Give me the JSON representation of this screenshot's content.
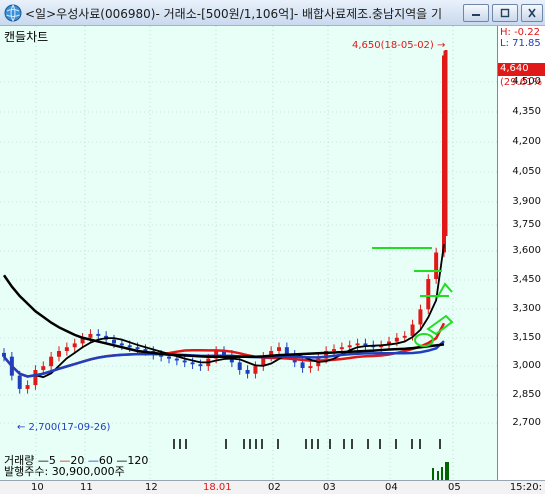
{
  "window": {
    "title": "<일>우성사료(006980)- 거래소-[500원/1,106억]- 배합사료제조.충남지역을 기",
    "minimize_icon": "minimize-icon",
    "restore_icon": "restore-icon",
    "close_icon": "close-icon"
  },
  "chart": {
    "label": "캔들차트",
    "high_annotation": "4,650(18-05-02) →",
    "low_annotation": "← 2,700(17-09-26)",
    "side_high": "H: -0.22",
    "side_low": "L: 71.85",
    "current_price": "4,640",
    "current_pct": "(29.61%",
    "price_ticks": [
      "4,500",
      "4,350",
      "4,200",
      "4,050",
      "3,900",
      "3,750",
      "3,600",
      "3,450",
      "3,300",
      "3,150",
      "3,000",
      "2,850",
      "2,700"
    ],
    "colors": {
      "up": "#e01818",
      "down": "#1f3fbf",
      "ma5": "#e01818",
      "ma20": "#e01818",
      "ma60": "#1f3fbf",
      "ma120": "#000000",
      "box": "#22dd22"
    }
  },
  "volume": {
    "legend_label": "거래량",
    "ma_labels": [
      "5",
      "20",
      "60",
      "120"
    ],
    "shares_label": "발행주수:",
    "shares_value": "30,900,000주"
  },
  "dates": {
    "ticks": [
      "10",
      "11",
      "12",
      "18.01",
      "02",
      "03",
      "04",
      "05"
    ],
    "time": "15:20:"
  },
  "chart_data": {
    "type": "candlestick",
    "ylim": [
      2650,
      4700
    ],
    "high": {
      "value": 4650,
      "date": "18-05-02"
    },
    "low": {
      "value": 2700,
      "date": "17-09-26"
    },
    "close_series": [
      3050,
      2950,
      2880,
      2900,
      2980,
      3000,
      3050,
      3080,
      3100,
      3120,
      3150,
      3170,
      3160,
      3140,
      3120,
      3110,
      3100,
      3090,
      3080,
      3060,
      3050,
      3040,
      3030,
      3020,
      3010,
      3000,
      3040,
      3080,
      3060,
      3020,
      2980,
      2960,
      3000,
      3050,
      3080,
      3100,
      3060,
      3020,
      2990,
      3000,
      3040,
      3080,
      3090,
      3100,
      3110,
      3120,
      3110,
      3100,
      3110,
      3130,
      3150,
      3160,
      3220,
      3300,
      3460,
      3600,
      4640
    ],
    "ma120_series": [
      3480,
      3420,
      3370,
      3330,
      3290,
      3260,
      3230,
      3205,
      3185,
      3165,
      3150,
      3140,
      3130,
      3120,
      3110,
      3100,
      3090,
      3080,
      3075,
      3070,
      3065,
      3060,
      3058,
      3056,
      3054,
      3052,
      3050,
      3050,
      3050,
      3050,
      3050,
      3050,
      3050,
      3052,
      3055,
      3058,
      3060,
      3062,
      3064,
      3066,
      3068,
      3070,
      3072,
      3074,
      3076,
      3078,
      3080,
      3082,
      3085,
      3088,
      3090,
      3092,
      3095,
      3100,
      3105,
      3110,
      3115
    ]
  }
}
